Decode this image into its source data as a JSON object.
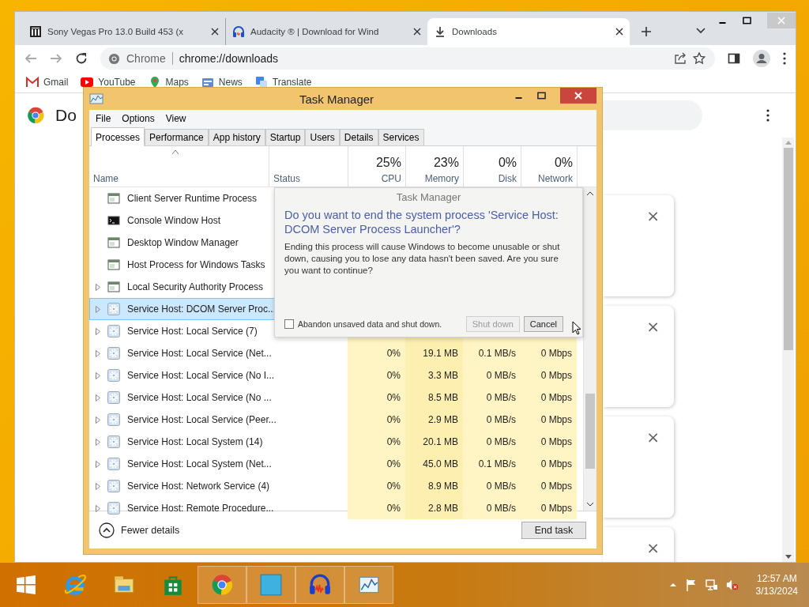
{
  "browser": {
    "tabs": [
      {
        "title": "Sony Vegas Pro 13.0 Build 453 (x",
        "kind": "building",
        "selected": false
      },
      {
        "title": "Audacity ® | Download for Wind",
        "kind": "headphones",
        "selected": false
      },
      {
        "title": "Downloads",
        "kind": "download",
        "selected": true
      }
    ],
    "address": {
      "chip": "Chrome",
      "url": "chrome://downloads"
    },
    "bookmarks": [
      {
        "label": "Gmail",
        "kind": "gmail"
      },
      {
        "label": "YouTube",
        "kind": "youtube"
      },
      {
        "label": "Maps",
        "kind": "maps"
      },
      {
        "label": "News",
        "kind": "news"
      },
      {
        "label": "Translate",
        "kind": "translate"
      }
    ],
    "page": {
      "heading": "Do",
      "cards": [
        {
          "remove": "×"
        },
        {
          "remove": "×"
        },
        {
          "remove": "×"
        },
        {
          "remove": "×"
        }
      ]
    }
  },
  "task_manager": {
    "title": "Task Manager",
    "menu": [
      "File",
      "Options",
      "View"
    ],
    "tabs": [
      {
        "label": "Processes",
        "selected": true
      },
      {
        "label": "Performance",
        "selected": false
      },
      {
        "label": "App history",
        "selected": false
      },
      {
        "label": "Startup",
        "selected": false
      },
      {
        "label": "Users",
        "selected": false
      },
      {
        "label": "Details",
        "selected": false
      },
      {
        "label": "Services",
        "selected": false
      }
    ],
    "columns": [
      {
        "label": "Name"
      },
      {
        "label": "Status"
      },
      {
        "label": "CPU",
        "usage": "25%"
      },
      {
        "label": "Memory",
        "usage": "23%"
      },
      {
        "label": "Disk",
        "usage": "0%"
      },
      {
        "label": "Network",
        "usage": "0%"
      }
    ],
    "rows": [
      {
        "name": "Client Server Runtime Process",
        "kind": "window",
        "expandable": false,
        "selected": false
      },
      {
        "name": "Console Window Host",
        "kind": "console",
        "expandable": false,
        "selected": false
      },
      {
        "name": "Desktop Window Manager",
        "kind": "window",
        "expandable": false,
        "selected": false
      },
      {
        "name": "Host Process for Windows Tasks",
        "kind": "window",
        "expandable": false,
        "selected": false
      },
      {
        "name": "Local Security Authority Process",
        "kind": "window",
        "expandable": true,
        "selected": false
      },
      {
        "name": "Service Host: DCOM Server Proc...",
        "kind": "gear",
        "expandable": true,
        "selected": true
      },
      {
        "name": "Service Host: Local Service (7)",
        "kind": "gear",
        "expandable": true,
        "selected": false
      },
      {
        "name": "Service Host: Local Service (Net...",
        "kind": "gear",
        "expandable": true,
        "selected": false,
        "cpu": "0%",
        "memory": "19.1 MB",
        "disk": "0.1 MB/s",
        "network": "0 Mbps"
      },
      {
        "name": "Service Host: Local Service (No I...",
        "kind": "gear",
        "expandable": true,
        "selected": false,
        "cpu": "0%",
        "memory": "3.3 MB",
        "disk": "0 MB/s",
        "network": "0 Mbps"
      },
      {
        "name": "Service Host: Local Service (No ...",
        "kind": "gear",
        "expandable": true,
        "selected": false,
        "cpu": "0%",
        "memory": "8.5 MB",
        "disk": "0 MB/s",
        "network": "0 Mbps"
      },
      {
        "name": "Service Host: Local Service (Peer...",
        "kind": "gear",
        "expandable": true,
        "selected": false,
        "cpu": "0%",
        "memory": "2.9 MB",
        "disk": "0 MB/s",
        "network": "0 Mbps"
      },
      {
        "name": "Service Host: Local System (14)",
        "kind": "gear",
        "expandable": true,
        "selected": false,
        "cpu": "0%",
        "memory": "20.1 MB",
        "disk": "0 MB/s",
        "network": "0 Mbps"
      },
      {
        "name": "Service Host: Local System (Net...",
        "kind": "gear",
        "expandable": true,
        "selected": false,
        "cpu": "0%",
        "memory": "45.0 MB",
        "disk": "0.1 MB/s",
        "network": "0 Mbps"
      },
      {
        "name": "Service Host: Network Service (4)",
        "kind": "gear",
        "expandable": true,
        "selected": false,
        "cpu": "0%",
        "memory": "8.9 MB",
        "disk": "0 MB/s",
        "network": "0 Mbps"
      },
      {
        "name": "Service Host: Remote Procedure...",
        "kind": "gear",
        "expandable": true,
        "selected": false,
        "cpu": "0%",
        "memory": "2.8 MB",
        "disk": "0 MB/s",
        "network": "0 Mbps"
      }
    ],
    "footer": {
      "details": "Fewer details",
      "end_task": "End task"
    },
    "dialog": {
      "title": "Task Manager",
      "question": "Do you want to end the system process 'Service Host: DCOM Server Process Launcher'?",
      "message": "Ending this process will cause Windows to become unusable or shut down, causing you to lose any data hasn't been saved. Are you sure you want to continue?",
      "checkbox": {
        "label": "Abandon unsaved data and shut down.",
        "checked": false
      },
      "buttons": [
        {
          "label": "Shut down",
          "disabled": true
        },
        {
          "label": "Cancel",
          "disabled": false
        }
      ]
    }
  },
  "taskbar": {
    "apps": [
      {
        "kind": "start",
        "active": false
      },
      {
        "kind": "ie",
        "active": false
      },
      {
        "kind": "explorer",
        "active": false
      },
      {
        "kind": "store",
        "active": false
      },
      {
        "kind": "chrome",
        "active": true
      },
      {
        "kind": "blank",
        "active": true
      },
      {
        "kind": "audacity",
        "active": true
      },
      {
        "kind": "taskmanager",
        "active": true
      }
    ],
    "time": "12:57 AM",
    "date": "3/13/2024"
  }
}
